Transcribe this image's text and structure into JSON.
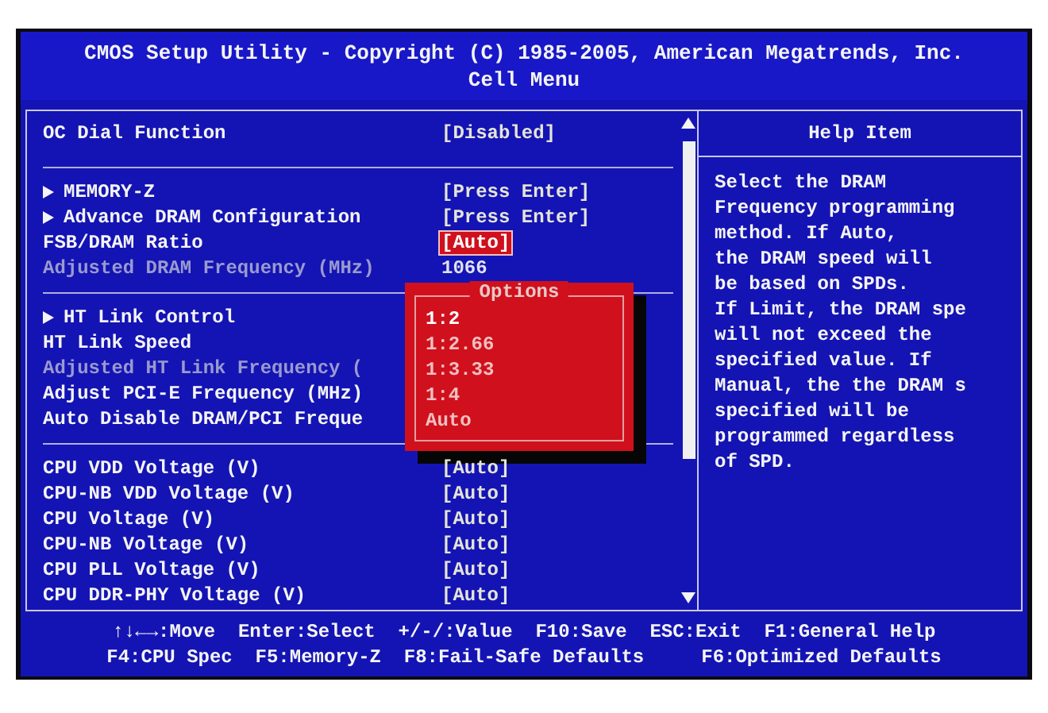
{
  "title_bar": {
    "title": "CMOS Setup Utility - Copyright (C) 1985-2005, American Megatrends, Inc.",
    "subtitle": "Cell Menu"
  },
  "settings": {
    "header": {
      "label": "OC Dial Function",
      "value": "[Disabled]"
    },
    "groups": [
      [
        {
          "kind": "submenu",
          "label": "MEMORY-Z",
          "value": "[Press Enter]",
          "disabled": false,
          "selected": false
        },
        {
          "kind": "submenu",
          "label": "Advance DRAM Configuration",
          "value": "[Press Enter]",
          "disabled": false,
          "selected": false
        },
        {
          "kind": "setting",
          "label": "FSB/DRAM Ratio",
          "value": "[Auto]",
          "disabled": false,
          "selected": true
        },
        {
          "kind": "setting",
          "label": "Adjusted DRAM Frequency (MHz)",
          "value": "1066",
          "disabled": true,
          "selected": false
        }
      ],
      [
        {
          "kind": "submenu",
          "label": "HT Link Control",
          "disabled": false
        },
        {
          "kind": "setting",
          "label": "HT Link Speed",
          "disabled": false
        },
        {
          "kind": "setting",
          "label": "Adjusted HT Link Frequency (",
          "disabled": true
        },
        {
          "kind": "setting",
          "label": "Adjust PCI-E Frequency (MHz)",
          "disabled": false
        },
        {
          "kind": "setting",
          "label": "Auto Disable DRAM/PCI Freque",
          "disabled": false
        }
      ],
      [
        {
          "kind": "setting",
          "label": "CPU VDD Voltage (V)",
          "value": "[Auto]",
          "disabled": false,
          "selected": false
        },
        {
          "kind": "setting",
          "label": "CPU-NB VDD Voltage (V)",
          "value": "[Auto]",
          "disabled": false,
          "selected": false
        },
        {
          "kind": "setting",
          "label": "CPU Voltage (V)",
          "value": "[Auto]",
          "disabled": false,
          "selected": false
        },
        {
          "kind": "setting",
          "label": "CPU-NB Voltage (V)",
          "value": "[Auto]",
          "disabled": false,
          "selected": false
        },
        {
          "kind": "setting",
          "label": "CPU PLL Voltage (V)",
          "value": "[Auto]",
          "disabled": false,
          "selected": false
        },
        {
          "kind": "setting",
          "label": "CPU DDR-PHY Voltage (V)",
          "value": "[Auto]",
          "disabled": false,
          "selected": false
        }
      ]
    ]
  },
  "options_popup": {
    "title": "Options",
    "options": [
      {
        "label": "1:2",
        "selected": true
      },
      {
        "label": "1:2.66",
        "selected": false
      },
      {
        "label": "1:3.33",
        "selected": false
      },
      {
        "label": "1:4",
        "selected": false
      },
      {
        "label": "Auto",
        "selected": false
      }
    ]
  },
  "help": {
    "title": "Help Item",
    "lines": [
      "Select the DRAM",
      "Frequency programming",
      "method. If Auto,",
      "the DRAM speed will",
      "be based on SPDs.",
      "If Limit, the DRAM spe",
      "will not exceed the",
      "specified value. If",
      "Manual, the the DRAM s",
      "specified will be",
      "programmed regardless",
      "of SPD."
    ]
  },
  "footer": {
    "lines": [
      "↑↓←→:Move  Enter:Select  +/-/:Value  F10:Save  ESC:Exit  F1:General Help",
      "F4:CPU Spec  F5:Memory-Z  F8:Fail-Safe Defaults     F6:Optimized Defaults"
    ]
  }
}
